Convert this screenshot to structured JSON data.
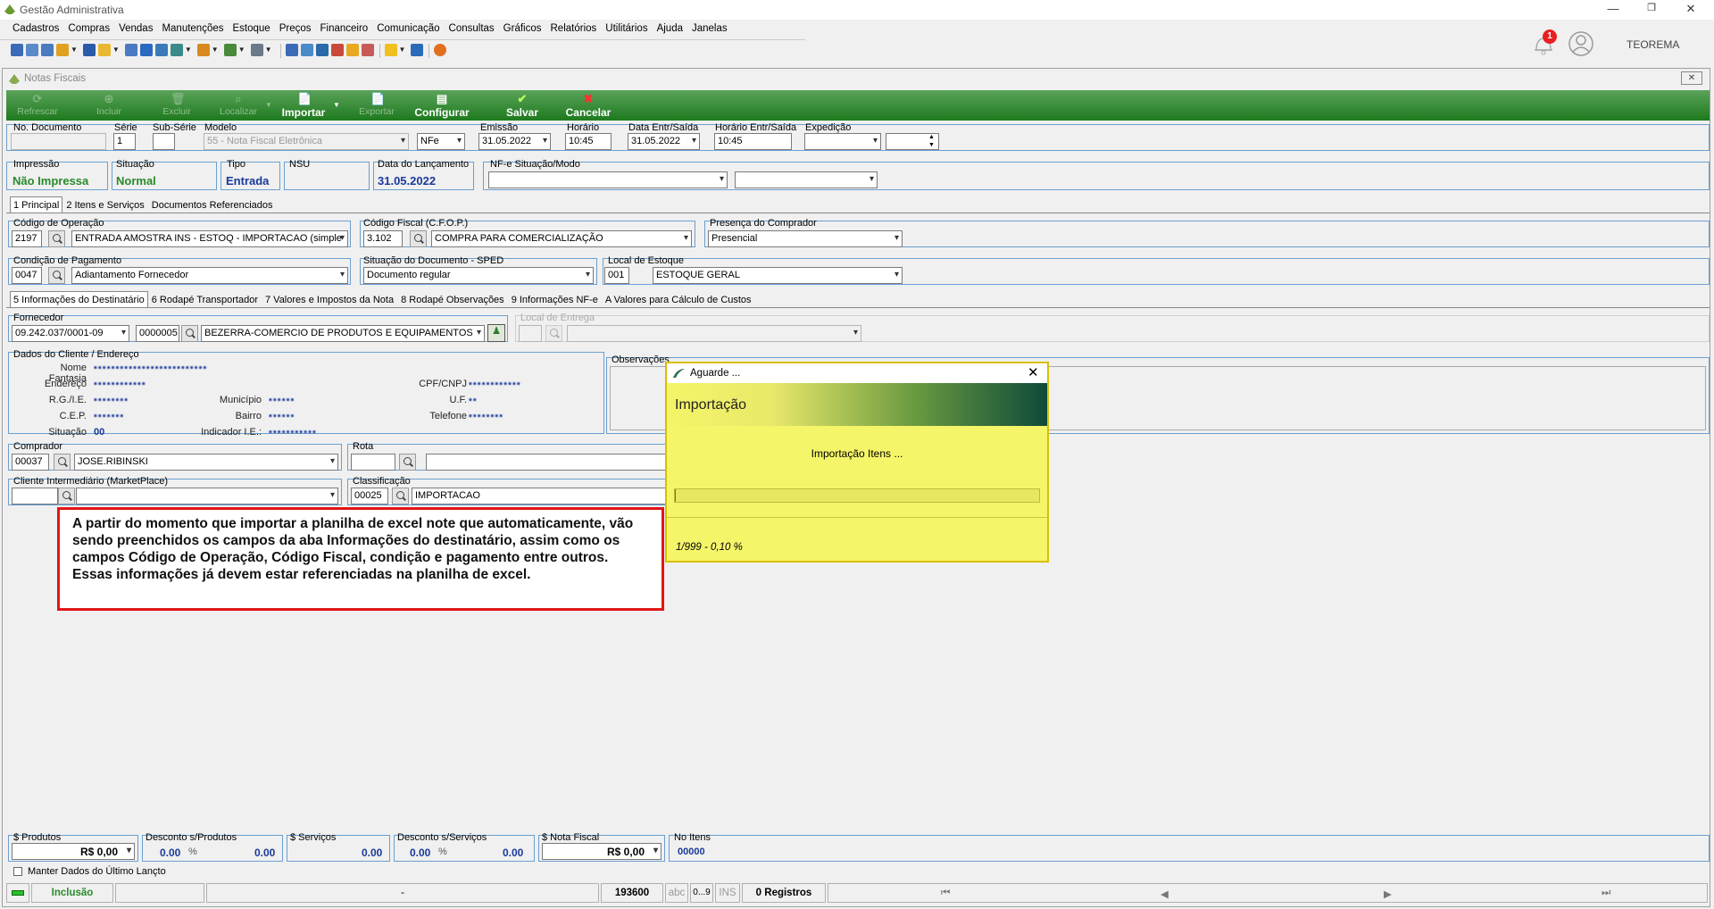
{
  "window": {
    "title": "Gestão Administrativa",
    "user": "TEOREMA",
    "notifications": "1"
  },
  "menu": [
    "Cadastros",
    "Compras",
    "Vendas",
    "Manutenções",
    "Estoque",
    "Preços",
    "Financeiro",
    "Comunicação",
    "Consultas",
    "Gráficos",
    "Relatórios",
    "Utilitários",
    "Ajuda",
    "Janelas"
  ],
  "doc_window": {
    "title": "Notas Fiscais"
  },
  "actions": {
    "refresh": "Refrescar",
    "include": "Incluir",
    "delete": "Excluir",
    "find": "Localizar",
    "import": "Importar",
    "export": "Exportar",
    "configure": "Configurar",
    "save": "Salvar",
    "cancel": "Cancelar"
  },
  "header": {
    "no_documento": {
      "label": "No. Documento",
      "value": ""
    },
    "serie": {
      "label": "Série",
      "value": "1"
    },
    "subserie": {
      "label": "Sub-Série",
      "value": ""
    },
    "modelo": {
      "label": "Modelo",
      "value": "55 - Nota Fiscal Eletrônica",
      "kind": "NFe"
    },
    "emissao": {
      "label": "Emissão",
      "value": "31.05.2022"
    },
    "horario": {
      "label": "Horário",
      "value": "10:45"
    },
    "data_entr": {
      "label": "Data Entr/Saída",
      "value": "31.05.2022"
    },
    "horario_entr": {
      "label": "Horário Entr/Saída",
      "value": "10:45"
    },
    "expedicao": {
      "label": "Expedição",
      "value": ""
    }
  },
  "status_row": {
    "impressao": {
      "label": "Impressão",
      "value": "Não Impressa"
    },
    "situacao": {
      "label": "Situação",
      "value": "Normal"
    },
    "tipo": {
      "label": "Tipo",
      "value": "Entrada"
    },
    "nsu": {
      "label": "NSU",
      "value": ""
    },
    "lancamento": {
      "label": "Data do Lançamento",
      "value": "31.05.2022"
    },
    "nfe_situacao": {
      "label": "NF-e Situação/Modo",
      "value": ""
    }
  },
  "tabs": [
    "1 Principal",
    "2 Itens e Serviços",
    "Documentos Referenciados"
  ],
  "principal": {
    "cod_operacao": {
      "label": "Código de Operação",
      "code": "2197",
      "value": "ENTRADA AMOSTRA INS - ESTOQ - IMPORTACAO (simple"
    },
    "cfop": {
      "label": "Código Fiscal (C.F.O.P.)",
      "code": "3.102",
      "value": "COMPRA PARA COMERCIALIZAÇÃO"
    },
    "presenca": {
      "label": "Presença do Comprador",
      "value": "Presencial"
    },
    "cond_pagamento": {
      "label": "Condição de Pagamento",
      "code": "0047",
      "value": "Adiantamento Fornecedor"
    },
    "situacao_sped": {
      "label": "Situação do Documento - SPED",
      "value": "Documento regular"
    },
    "local_estoque": {
      "label": "Local de Estoque",
      "code": "001",
      "value": "ESTOQUE GERAL"
    }
  },
  "subtabs": [
    "5 Informações do Destinatário",
    "6 Rodapé Transportador",
    "7 Valores e Impostos da Nota",
    "8 Rodapé Observações",
    "9 Informações NF-e",
    "A Valores para Cálculo de Custos"
  ],
  "fornecedor": {
    "label": "Fornecedor",
    "cnpj": "09.242.037/0001-09",
    "code": "0000005",
    "name": "BEZERRA-COMERCIO DE PRODUTOS E EQUIPAMENTOS",
    "local_entrega": "Local de Entrega"
  },
  "cliente": {
    "title": "Dados do Cliente / Endereço",
    "labels": {
      "fantasia": "Nome Fantasia",
      "endereco": "Endereço",
      "rg": "R.G./I.E.",
      "cep": "C.E.P.",
      "situacao": "Situação",
      "municipio": "Município",
      "bairro": "Bairro",
      "indicador": "Indicador I.E.:",
      "cpf": "CPF/CNPJ",
      "uf": "U.F.",
      "telefone": "Telefone"
    },
    "situacao_value": "00",
    "observacoes": "Observações"
  },
  "comprador": {
    "label": "Comprador",
    "code": "00037",
    "value": "JOSE.RIBINSKI"
  },
  "rota": {
    "label": "Rota",
    "code": "",
    "value": ""
  },
  "intermediario": {
    "label": "Cliente Intermediário (MarketPlace)",
    "code": "",
    "value": ""
  },
  "classificacao": {
    "label": "Classificação",
    "code": "00025",
    "value": "IMPORTACAO"
  },
  "dialog": {
    "title": "Aguarde ...",
    "heading": "Importação",
    "message": "Importação Itens ...",
    "progress_text": "1/999 - 0,10 %",
    "progress": 0.001
  },
  "callout": "A partir do momento que importar a planilha de excel note que automaticamente, vão sendo preenchidos os campos da aba Informações do destinatário, assim como os campos Código de Operação, Código Fiscal, condição e pagamento entre outros. Essas informações já devem estar referenciadas na planilha de excel.",
  "totals": {
    "produtos": {
      "label": "$ Produtos",
      "value": "R$ 0,00"
    },
    "desc_produtos": {
      "label": "Desconto s/Produtos",
      "pct": "0.00",
      "pct_sign": "%",
      "value": "0.00"
    },
    "servicos": {
      "label": "$ Serviços",
      "value": "0.00"
    },
    "desc_servicos": {
      "label": "Desconto s/Serviços",
      "pct": "0.00",
      "pct_sign": "%",
      "value": "0.00"
    },
    "nota_fiscal": {
      "label": "$ Nota Fiscal",
      "value": "R$ 0,00"
    },
    "no_itens": {
      "label": "No Itens",
      "value": "00000"
    }
  },
  "keep_data": "Manter Dados do Último Lançto",
  "statusbar": {
    "mode": "Inclusão",
    "dash": "-",
    "number": "193600",
    "abc": "abc",
    "range": "0...9",
    "ins": "INS",
    "records": "0 Registros"
  }
}
